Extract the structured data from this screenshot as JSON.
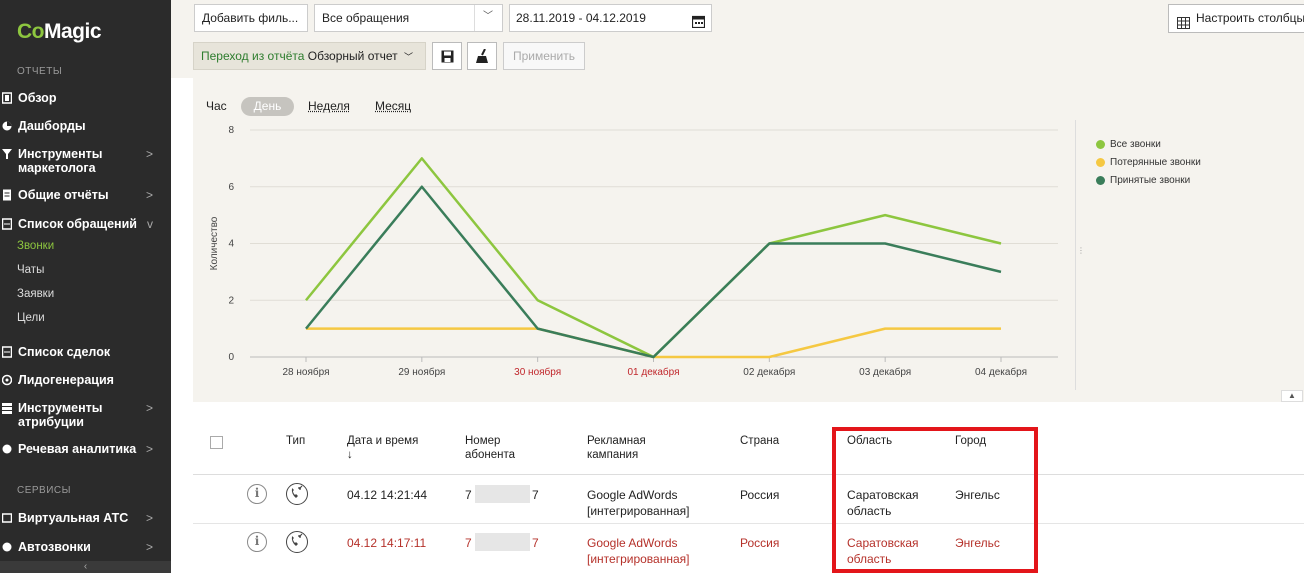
{
  "app": {
    "logo_co": "Co",
    "logo_magic": "Magic"
  },
  "sidebar": {
    "section_reports": "ОТЧЕТЫ",
    "section_services": "СЕРВИСЫ",
    "items": [
      {
        "label": "Обзор"
      },
      {
        "label": "Дашборды"
      },
      {
        "label": "Инструменты маркетолога",
        "line1": "Инструменты",
        "line2": "маркетолога",
        "chevron": ">"
      },
      {
        "label": "Общие отчёты",
        "chevron": ">"
      },
      {
        "label": "Список обращений",
        "chevron": "v"
      },
      {
        "label": "Список сделок"
      },
      {
        "label": "Лидогенерация"
      },
      {
        "label": "Инструменты атрибуции",
        "line1": "Инструменты",
        "line2": "атрибуции",
        "chevron": ">"
      },
      {
        "label": "Речевая аналитика",
        "chevron": ">"
      },
      {
        "label": "Виртуальная АТС",
        "chevron": ">"
      },
      {
        "label": "Автозвонки",
        "chevron": ">"
      }
    ],
    "subitems": [
      "Звонки",
      "Чаты",
      "Заявки",
      "Цели"
    ],
    "collapse": "‹"
  },
  "filters": {
    "add_filter": "Добавить филь...",
    "requests_select": "Все обращения",
    "date_range": "28.11.2019 - 04.12.2019",
    "report_prefix": "Переход из отчёта",
    "report_name": "Обзорный отчет",
    "apply": "Применить",
    "configure_columns": "Настроить столбцы"
  },
  "periods": {
    "hour": "Час",
    "day": "День",
    "week": "Неделя",
    "month": "Месяц"
  },
  "chart_data": {
    "type": "line",
    "ylabel": "Количество",
    "ylim": [
      0,
      8
    ],
    "yticks": [
      0,
      2,
      4,
      6,
      8
    ],
    "categories": [
      "28 ноября",
      "29 ноября",
      "30 ноября",
      "01 декабря",
      "02 декабря",
      "03 декабря",
      "04 декабря"
    ],
    "weekend_categories": [
      "30 ноября",
      "01 декабря"
    ],
    "grid": true,
    "legend_position": "right",
    "series": [
      {
        "name": "Все звонки",
        "color": "#8dc63f",
        "values": [
          2,
          7,
          2,
          0,
          4,
          5,
          4
        ]
      },
      {
        "name": "Потерянные звонки",
        "color": "#f5c842",
        "values": [
          1,
          1,
          1,
          0,
          0,
          1,
          1
        ]
      },
      {
        "name": "Принятые звонки",
        "color": "#3a7d5a",
        "values": [
          1,
          6,
          1,
          0,
          4,
          4,
          3
        ]
      }
    ]
  },
  "table": {
    "headers": {
      "type": "Тип",
      "datetime": "Дата и время",
      "sort_arrow": "↓",
      "number_l1": "Номер",
      "number_l2": "абонента",
      "campaign_l1": "Рекламная",
      "campaign_l2": "кампания",
      "country": "Страна",
      "region": "Область",
      "city": "Город"
    },
    "rows": [
      {
        "datetime": "04.12 14:21:44",
        "num_start": "7",
        "num_end": "7",
        "campaign_l1": "Google AdWords",
        "campaign_l2": "[интегрированная]",
        "country": "Россия",
        "region_l1": "Саратовская",
        "region_l2": "область",
        "city": "Энгельс"
      },
      {
        "datetime": "04.12 14:17:11",
        "num_start": "7",
        "num_end": "7",
        "campaign_l1": "Google AdWords",
        "campaign_l2": "[интегрированная]",
        "country": "Россия",
        "region_l1": "Саратовская",
        "region_l2": "область",
        "city": "Энгельс"
      }
    ]
  },
  "icons": {
    "info": "i"
  }
}
